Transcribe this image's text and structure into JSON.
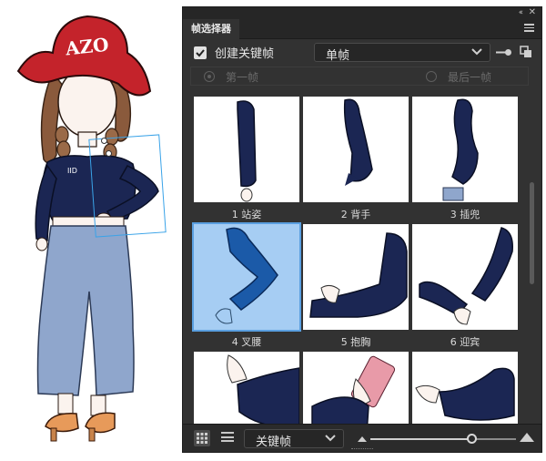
{
  "art": {
    "cap_text": "AZO",
    "shirt_text": "IID"
  },
  "panel": {
    "tab_title": "帧选择器",
    "create_keyframe_label": "创建关键帧",
    "create_keyframe_checked": true,
    "frame_mode_value": "单帧",
    "first_frame_label": "第一帧",
    "last_frame_label": "最后一帧",
    "frames": [
      {
        "caption": "1 站姿"
      },
      {
        "caption": "2 背手"
      },
      {
        "caption": "3 插兜"
      },
      {
        "caption": "4 叉腰",
        "selected": true
      },
      {
        "caption": "5 抱胸"
      },
      {
        "caption": "6 迎宾"
      },
      {
        "caption": ""
      },
      {
        "caption": ""
      },
      {
        "caption": ""
      }
    ],
    "filter_value": "关键帧",
    "thumbnail_zoom": 0.7
  },
  "colors": {
    "panel_bg": "#323232",
    "selection_blue": "#a6cdf3",
    "sleeve_navy": "#1b2653"
  }
}
